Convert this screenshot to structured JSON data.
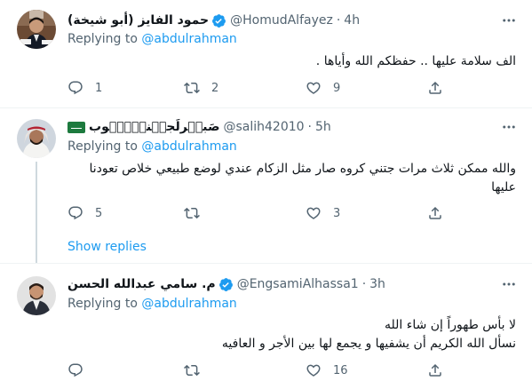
{
  "tweets": [
    {
      "display_name": "حمود الفايز (أبو شيخة)",
      "handle": "@HomudAlfayez",
      "time": "4h",
      "replying_prefix": "Replying to",
      "replying_to": "@abdulrahman",
      "body": [
        "الف سلامة عليها .. حفظكم الله وأياها ."
      ],
      "replies": "1",
      "retweets": "2",
      "likes": "9",
      "verified": true
    },
    {
      "display_name": "صَبۣۗرلَجۣۗنۣۗۗۗۗوب",
      "handle": "@salih42010",
      "time": "5h",
      "replying_prefix": "Replying to",
      "replying_to": "@abdulrahman",
      "body": [
        "والله ممكن ثلاث مرات جتني كروه صار مثل الزكام عندي لوضع طبيعي خلاص تعودنا",
        "عليها"
      ],
      "replies": "5",
      "retweets": "",
      "likes": "3",
      "verified": false
    },
    {
      "display_name": "م. سامي عبدالله الحسن",
      "handle": "@EngsamiAlhassa1",
      "time": "3h",
      "replying_prefix": "Replying to",
      "replying_to": "@abdulrahman",
      "body": [
        "لا بأس طهوراً إن شاء الله",
        "نسأل الله الكريم أن يشفيها و يجمع لها بين الأجر و العافيه"
      ],
      "replies": "",
      "retweets": "",
      "likes": "16",
      "verified": true
    }
  ],
  "show_replies": "Show replies",
  "dot": "·",
  "colors": {
    "accent": "#1d9bf0",
    "muted": "#536471",
    "divider": "#eff3f4",
    "flag": "#1d7a3e"
  },
  "icons": {
    "reply": "reply-icon",
    "retweet": "retweet-icon",
    "like": "heart-icon",
    "share": "share-icon",
    "more": "more-icon",
    "verified": "verified-badge-icon"
  }
}
